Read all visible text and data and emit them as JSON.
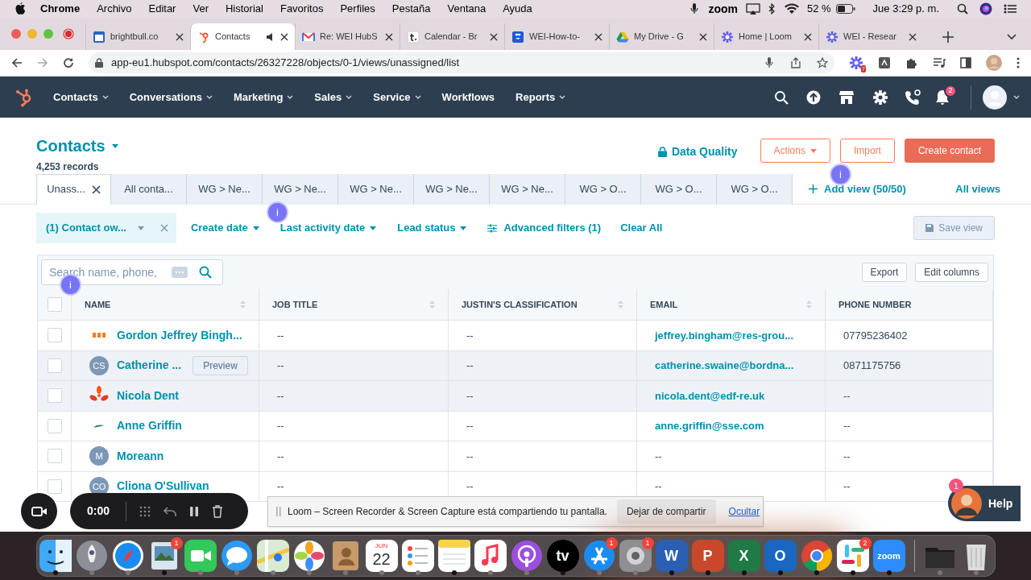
{
  "menu_bar": {
    "app": "Chrome",
    "items": [
      "Archivo",
      "Editar",
      "Ver",
      "Historial",
      "Favoritos",
      "Perfiles",
      "Pestaña",
      "Ventana",
      "Ayuda"
    ],
    "zoom_label": "zoom",
    "battery": "52 %",
    "clock": "Jue 3:29 p. m."
  },
  "browser": {
    "tabs": [
      {
        "title": "brightbull.co",
        "kind": "calendar",
        "selected": false
      },
      {
        "title": "Contacts",
        "kind": "hubspot",
        "selected": true
      },
      {
        "title": "Re: WEI HubS",
        "kind": "gmail",
        "selected": false
      },
      {
        "title": "Calendar - Br",
        "kind": "letter",
        "selected": false
      },
      {
        "title": "WEI-How-to-",
        "kind": "dropbox",
        "selected": false
      },
      {
        "title": "My Drive - G",
        "kind": "drive",
        "selected": false
      },
      {
        "title": "Home | Loom",
        "kind": "loom",
        "selected": false
      },
      {
        "title": "WEI - Resear",
        "kind": "loom",
        "selected": false
      }
    ],
    "url": "app-eu1.hubspot.com/contacts/26327228/objects/0-1/views/unassigned/list",
    "extension_badge": "7"
  },
  "nav": {
    "items": [
      {
        "label": "Contacts",
        "dropdown": true
      },
      {
        "label": "Conversations",
        "dropdown": true
      },
      {
        "label": "Marketing",
        "dropdown": true
      },
      {
        "label": "Sales",
        "dropdown": true
      },
      {
        "label": "Service",
        "dropdown": true
      },
      {
        "label": "Workflows",
        "dropdown": false
      },
      {
        "label": "Reports",
        "dropdown": true
      }
    ],
    "notifications": "2"
  },
  "header": {
    "title": "Contacts",
    "records": "4,253 records",
    "data_quality": "Data Quality",
    "buttons": [
      {
        "label": "Actions",
        "kind": "menu"
      },
      {
        "label": "Import",
        "kind": "outline"
      },
      {
        "label": "Create contact",
        "kind": "primary"
      }
    ]
  },
  "view_tabs": [
    {
      "label": "Unass...",
      "selected": true
    },
    {
      "label": "All conta...",
      "selected": false
    },
    {
      "label": "WG > Ne...",
      "selected": false
    },
    {
      "label": "WG > Ne...",
      "selected": false
    },
    {
      "label": "WG > Ne...",
      "selected": false
    },
    {
      "label": "WG > Ne...",
      "selected": false
    },
    {
      "label": "WG > Ne...",
      "selected": false
    },
    {
      "label": "WG > O...",
      "selected": false
    },
    {
      "label": "WG > O...",
      "selected": false
    },
    {
      "label": "WG > O...",
      "selected": false
    }
  ],
  "add_view": "Add view (50/50)",
  "all_views": "All views",
  "filters": [
    {
      "label": "(1) Contact ow...",
      "kind": "active"
    },
    {
      "label": "Create date",
      "kind": "dropdown"
    },
    {
      "label": "Last activity date",
      "kind": "dropdown"
    },
    {
      "label": "Lead status",
      "kind": "dropdown"
    },
    {
      "label": "Advanced filters (1)",
      "kind": "advanced"
    },
    {
      "label": "Clear All",
      "kind": "link"
    }
  ],
  "save_view": "Save view",
  "table": {
    "select_all_checked": false,
    "search": {
      "placeholder": "Search name, phone,"
    },
    "actions": [
      "Export",
      "Edit columns"
    ],
    "columns": [
      {
        "label": "NAME",
        "sortable": true
      },
      {
        "label": "JOB TITLE",
        "sortable": true
      },
      {
        "label": "JUSTIN'S CLASSIFICATION",
        "sortable": true
      },
      {
        "label": "EMAIL",
        "sortable": true
      },
      {
        "label": "PHONE NUMBER",
        "sortable": false
      }
    ],
    "rows": [
      {
        "avatar": {
          "kind": "logo-res"
        },
        "name": "Gordon Jeffrey Bingh...",
        "job_title": "--",
        "classification": "--",
        "email": "jeffrey.bingham@res-grou...",
        "phone": "07795236402",
        "highlighted": false,
        "checked": false
      },
      {
        "avatar": {
          "kind": "initials",
          "text": "CS"
        },
        "name": "Catherine ...",
        "preview": "Preview",
        "job_title": "--",
        "classification": "--",
        "email": "catherine.swaine@bordna...",
        "phone": "0871175756",
        "highlighted": true,
        "checked": false
      },
      {
        "avatar": {
          "kind": "logo-flower"
        },
        "name": "Nicola Dent",
        "job_title": "--",
        "classification": "--",
        "email": "nicola.dent@edf-re.uk",
        "phone": "--",
        "highlighted": true,
        "checked": false
      },
      {
        "avatar": {
          "kind": "logo-leaf"
        },
        "name": "Anne Griffin",
        "job_title": "--",
        "classification": "--",
        "email": "anne.griffin@sse.com",
        "phone": "--",
        "highlighted": false,
        "checked": false
      },
      {
        "avatar": {
          "kind": "initials",
          "text": "M"
        },
        "name": "Moreann",
        "job_title": "--",
        "classification": "--",
        "email": "--",
        "phone": "--",
        "highlighted": false,
        "checked": false
      },
      {
        "avatar": {
          "kind": "initials",
          "text": "CO"
        },
        "name": "Cliona O'Sullivan",
        "job_title": "--",
        "classification": "--",
        "email": "--",
        "phone": "--",
        "highlighted": false,
        "checked": false
      }
    ]
  },
  "loom_markers": [
    "i",
    "i",
    "i"
  ],
  "recorder": {
    "time": "0:00"
  },
  "share_bar": {
    "message": "Loom – Screen Recorder & Screen Capture está compartiendo tu pantalla.",
    "stop": "Dejar de compartir",
    "hide": "Ocultar"
  },
  "help": {
    "label": "Help",
    "badge": "1"
  },
  "dock": [
    {
      "kind": "finder",
      "running": true
    },
    {
      "kind": "launchpad",
      "running": false
    },
    {
      "kind": "safari",
      "running": false
    },
    {
      "kind": "preview",
      "running": true,
      "badge": "1"
    },
    {
      "kind": "facetime",
      "running": false
    },
    {
      "kind": "messages",
      "running": false
    },
    {
      "kind": "maps",
      "running": false
    },
    {
      "kind": "photos",
      "running": false
    },
    {
      "kind": "contacts",
      "running": false
    },
    {
      "kind": "calendar",
      "running": false,
      "month": "JUN",
      "day": "22"
    },
    {
      "kind": "reminders",
      "running": false
    },
    {
      "kind": "notes",
      "running": true
    },
    {
      "kind": "music",
      "running": false
    },
    {
      "kind": "podcasts",
      "running": false
    },
    {
      "kind": "tv",
      "running": true,
      "glyph": "tv"
    },
    {
      "kind": "appstore",
      "running": false,
      "badge": "1"
    },
    {
      "kind": "settings",
      "running": false,
      "badge": "1"
    },
    {
      "kind": "word",
      "running": true,
      "glyph": "W"
    },
    {
      "kind": "powerpoint",
      "running": true,
      "glyph": "P"
    },
    {
      "kind": "excel",
      "running": true,
      "glyph": "X"
    },
    {
      "kind": "outlook",
      "running": true,
      "glyph": "O"
    },
    {
      "kind": "chrome",
      "running": true
    },
    {
      "kind": "slack",
      "running": true,
      "badge": "2"
    },
    {
      "kind": "zoom",
      "running": true,
      "glyph": "zoom"
    },
    {
      "kind": "divider"
    },
    {
      "kind": "folder",
      "running": false
    },
    {
      "kind": "trash",
      "running": false
    }
  ]
}
